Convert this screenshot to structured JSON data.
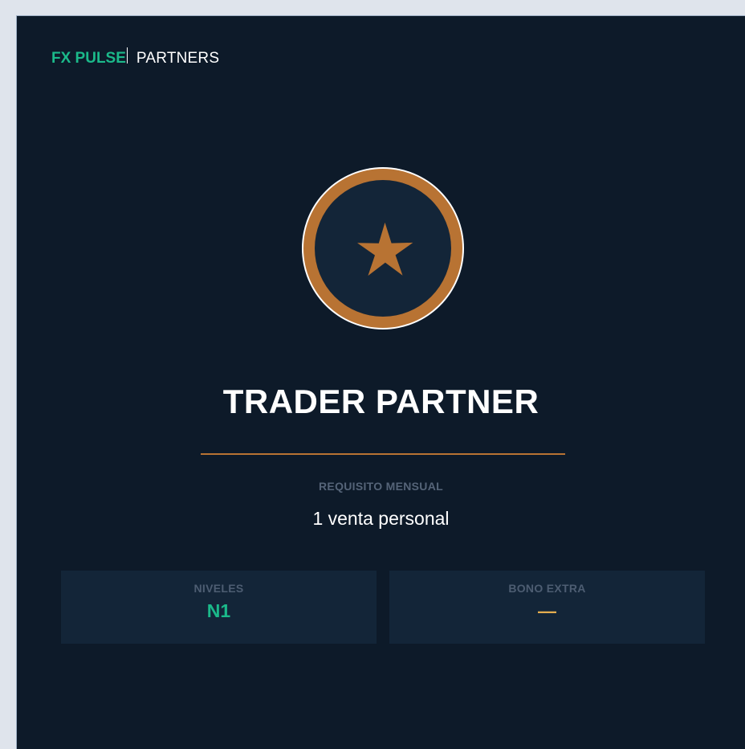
{
  "brand": {
    "name": "FX PULSE",
    "section": "PARTNERS"
  },
  "badge": {
    "icon": "star-icon",
    "ring_color": "#b87333",
    "inner_color": "#132538"
  },
  "tier": {
    "title": "TRADER PARTNER",
    "requirement_label": "REQUISITO MENSUAL",
    "requirement_value": "1 venta personal"
  },
  "stats": [
    {
      "label": "NIVELES",
      "value": "N1",
      "color": "#1bb98a"
    },
    {
      "label": "BONO EXTRA",
      "value": "—",
      "color": "#e3ad4f"
    }
  ],
  "colors": {
    "background": "#0d1a29",
    "accent_green": "#1bb98a",
    "accent_copper": "#b87333",
    "panel": "#132538"
  }
}
